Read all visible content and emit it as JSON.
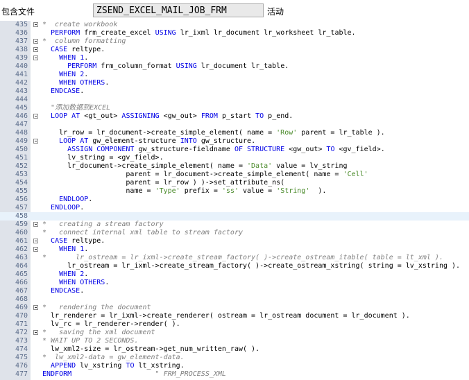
{
  "header": {
    "include_label": "包含文件",
    "program_name": "ZSEND_EXCEL_MAIL_JOB_FRM",
    "status_label": "活动"
  },
  "editor": {
    "lines": [
      {
        "n": "435",
        "fold": true,
        "hl": false,
        "seg": [
          [
            "cm",
            "*  create workbook"
          ]
        ]
      },
      {
        "n": "436",
        "fold": false,
        "hl": false,
        "seg": [
          [
            "t",
            "  "
          ],
          [
            "kw",
            "PERFORM"
          ],
          [
            "t",
            " frm_create_excel "
          ],
          [
            "kw",
            "USING"
          ],
          [
            "t",
            " lr_ixml lr_document lr_worksheet lr_table."
          ]
        ]
      },
      {
        "n": "437",
        "fold": true,
        "hl": false,
        "seg": [
          [
            "cm",
            "*  column formatting"
          ]
        ]
      },
      {
        "n": "438",
        "fold": true,
        "hl": false,
        "seg": [
          [
            "t",
            "  "
          ],
          [
            "kw",
            "CASE"
          ],
          [
            "t",
            " reltype."
          ]
        ]
      },
      {
        "n": "439",
        "fold": true,
        "hl": false,
        "seg": [
          [
            "t",
            "    "
          ],
          [
            "kw",
            "WHEN"
          ],
          [
            "t",
            " "
          ],
          [
            "nu",
            "1"
          ],
          [
            "t",
            "."
          ]
        ]
      },
      {
        "n": "440",
        "fold": false,
        "hl": false,
        "seg": [
          [
            "t",
            "      "
          ],
          [
            "kw",
            "PERFORM"
          ],
          [
            "t",
            " frm_column_format "
          ],
          [
            "kw",
            "USING"
          ],
          [
            "t",
            " lr_document lr_table."
          ]
        ]
      },
      {
        "n": "441",
        "fold": false,
        "hl": false,
        "seg": [
          [
            "t",
            "    "
          ],
          [
            "kw",
            "WHEN"
          ],
          [
            "t",
            " "
          ],
          [
            "nu",
            "2"
          ],
          [
            "t",
            "."
          ]
        ]
      },
      {
        "n": "442",
        "fold": false,
        "hl": false,
        "seg": [
          [
            "t",
            "    "
          ],
          [
            "kw",
            "WHEN OTHERS"
          ],
          [
            "t",
            "."
          ]
        ]
      },
      {
        "n": "443",
        "fold": false,
        "hl": false,
        "seg": [
          [
            "t",
            "  "
          ],
          [
            "kw",
            "ENDCASE"
          ],
          [
            "t",
            "."
          ]
        ]
      },
      {
        "n": "444",
        "fold": false,
        "hl": false,
        "seg": [
          [
            "t",
            ""
          ]
        ]
      },
      {
        "n": "445",
        "fold": false,
        "hl": false,
        "seg": [
          [
            "t",
            "  "
          ],
          [
            "cm",
            "\"添加数据到EXCEL"
          ]
        ]
      },
      {
        "n": "446",
        "fold": true,
        "hl": false,
        "seg": [
          [
            "t",
            "  "
          ],
          [
            "kw",
            "LOOP AT"
          ],
          [
            "t",
            " <gt_out> "
          ],
          [
            "kw",
            "ASSIGNING"
          ],
          [
            "t",
            " <gw_out> "
          ],
          [
            "kw",
            "FROM"
          ],
          [
            "t",
            " p_start "
          ],
          [
            "kw",
            "TO"
          ],
          [
            "t",
            " p_end."
          ]
        ]
      },
      {
        "n": "447",
        "fold": false,
        "hl": false,
        "seg": [
          [
            "t",
            ""
          ]
        ]
      },
      {
        "n": "448",
        "fold": false,
        "hl": false,
        "seg": [
          [
            "t",
            "    lr_row = lr_document->create_simple_element( name = "
          ],
          [
            "st",
            "'Row'"
          ],
          [
            "t",
            " parent = lr_table )."
          ]
        ]
      },
      {
        "n": "449",
        "fold": true,
        "hl": false,
        "seg": [
          [
            "t",
            "    "
          ],
          [
            "kw",
            "LOOP AT"
          ],
          [
            "t",
            " gw_element-structure "
          ],
          [
            "kw",
            "INTO"
          ],
          [
            "t",
            " gw_structure."
          ]
        ]
      },
      {
        "n": "450",
        "fold": false,
        "hl": false,
        "seg": [
          [
            "t",
            "      "
          ],
          [
            "kw",
            "ASSIGN COMPONENT"
          ],
          [
            "t",
            " gw_structure-fieldname "
          ],
          [
            "kw",
            "OF STRUCTURE"
          ],
          [
            "t",
            " <gw_out> "
          ],
          [
            "kw",
            "TO"
          ],
          [
            "t",
            " <gv_field>."
          ]
        ]
      },
      {
        "n": "451",
        "fold": false,
        "hl": false,
        "seg": [
          [
            "t",
            "      lv_string = <gv_field>."
          ]
        ]
      },
      {
        "n": "452",
        "fold": false,
        "hl": false,
        "seg": [
          [
            "t",
            "      lr_document->create_simple_element( name = "
          ],
          [
            "st",
            "'Data'"
          ],
          [
            "t",
            " value = lv_string"
          ]
        ]
      },
      {
        "n": "453",
        "fold": false,
        "hl": false,
        "seg": [
          [
            "t",
            "                    parent = lr_document->create_simple_element( name = "
          ],
          [
            "st",
            "'Cell'"
          ]
        ]
      },
      {
        "n": "454",
        "fold": false,
        "hl": false,
        "seg": [
          [
            "t",
            "                    parent = lr_row ) )->set_attribute_ns("
          ]
        ]
      },
      {
        "n": "455",
        "fold": false,
        "hl": false,
        "seg": [
          [
            "t",
            "                    name = "
          ],
          [
            "st",
            "'Type'"
          ],
          [
            "t",
            " prefix = "
          ],
          [
            "st",
            "'ss'"
          ],
          [
            "t",
            " value = "
          ],
          [
            "st",
            "'String'"
          ],
          [
            "t",
            "  )."
          ]
        ]
      },
      {
        "n": "456",
        "fold": false,
        "hl": false,
        "seg": [
          [
            "t",
            "    "
          ],
          [
            "kw",
            "ENDLOOP"
          ],
          [
            "t",
            "."
          ]
        ]
      },
      {
        "n": "457",
        "fold": false,
        "hl": false,
        "seg": [
          [
            "t",
            "  "
          ],
          [
            "kw",
            "ENDLOOP"
          ],
          [
            "t",
            "."
          ]
        ]
      },
      {
        "n": "458",
        "fold": false,
        "hl": true,
        "seg": [
          [
            "t",
            ""
          ]
        ]
      },
      {
        "n": "459",
        "fold": true,
        "hl": false,
        "seg": [
          [
            "cm",
            "*   creating a stream factory"
          ]
        ]
      },
      {
        "n": "460",
        "fold": false,
        "hl": false,
        "seg": [
          [
            "cm",
            "*   connect internal xml table to stream factory"
          ]
        ]
      },
      {
        "n": "461",
        "fold": true,
        "hl": false,
        "seg": [
          [
            "t",
            "  "
          ],
          [
            "kw",
            "CASE"
          ],
          [
            "t",
            " reltype."
          ]
        ]
      },
      {
        "n": "462",
        "fold": true,
        "hl": false,
        "seg": [
          [
            "t",
            "    "
          ],
          [
            "kw",
            "WHEN"
          ],
          [
            "t",
            " "
          ],
          [
            "nu",
            "1"
          ],
          [
            "t",
            "."
          ]
        ]
      },
      {
        "n": "463",
        "fold": false,
        "hl": false,
        "seg": [
          [
            "cm",
            "*       lr_ostream = lr_ixml->create_stream_factory( )->create_ostream_itable( table = lt_xml )."
          ]
        ]
      },
      {
        "n": "464",
        "fold": false,
        "hl": false,
        "seg": [
          [
            "t",
            "      lr_ostream = lr_ixml->create_stream_factory( )->create_ostream_xstring( string = lv_xstring )."
          ]
        ]
      },
      {
        "n": "465",
        "fold": false,
        "hl": false,
        "seg": [
          [
            "t",
            "    "
          ],
          [
            "kw",
            "WHEN"
          ],
          [
            "t",
            " "
          ],
          [
            "nu",
            "2"
          ],
          [
            "t",
            "."
          ]
        ]
      },
      {
        "n": "466",
        "fold": false,
        "hl": false,
        "seg": [
          [
            "t",
            "    "
          ],
          [
            "kw",
            "WHEN OTHERS"
          ],
          [
            "t",
            "."
          ]
        ]
      },
      {
        "n": "467",
        "fold": false,
        "hl": false,
        "seg": [
          [
            "t",
            "  "
          ],
          [
            "kw",
            "ENDCASE"
          ],
          [
            "t",
            "."
          ]
        ]
      },
      {
        "n": "468",
        "fold": false,
        "hl": false,
        "seg": [
          [
            "t",
            ""
          ]
        ]
      },
      {
        "n": "469",
        "fold": true,
        "hl": false,
        "seg": [
          [
            "cm",
            "*   rendering the document"
          ]
        ]
      },
      {
        "n": "470",
        "fold": false,
        "hl": false,
        "seg": [
          [
            "t",
            "  lr_renderer = lr_ixml->create_renderer( ostream = lr_ostream document = lr_document )."
          ]
        ]
      },
      {
        "n": "471",
        "fold": false,
        "hl": false,
        "seg": [
          [
            "t",
            "  lv_rc = lr_renderer->render( )."
          ]
        ]
      },
      {
        "n": "472",
        "fold": true,
        "hl": false,
        "seg": [
          [
            "cm",
            "*   saving the xml document"
          ]
        ]
      },
      {
        "n": "473",
        "fold": false,
        "hl": false,
        "seg": [
          [
            "cm",
            "* WAIT UP TO 2 SECONDS."
          ]
        ]
      },
      {
        "n": "474",
        "fold": false,
        "hl": false,
        "seg": [
          [
            "t",
            "  lw_xml2-size = lr_ostream->get_num_written_raw( )."
          ]
        ]
      },
      {
        "n": "475",
        "fold": false,
        "hl": false,
        "seg": [
          [
            "cm",
            "*  lw_xml2-data = gw_element-data."
          ]
        ]
      },
      {
        "n": "476",
        "fold": false,
        "hl": false,
        "seg": [
          [
            "t",
            "  "
          ],
          [
            "kw",
            "APPEND"
          ],
          [
            "t",
            " lv_xstring "
          ],
          [
            "kw",
            "TO"
          ],
          [
            "t",
            " lt_xstring."
          ]
        ]
      },
      {
        "n": "477",
        "fold": false,
        "hl": false,
        "seg": [
          [
            "kw",
            "ENDFORM"
          ],
          [
            "t",
            "                    "
          ],
          [
            "cm",
            "\" FRM_PROCESS_XML"
          ]
        ]
      }
    ]
  }
}
